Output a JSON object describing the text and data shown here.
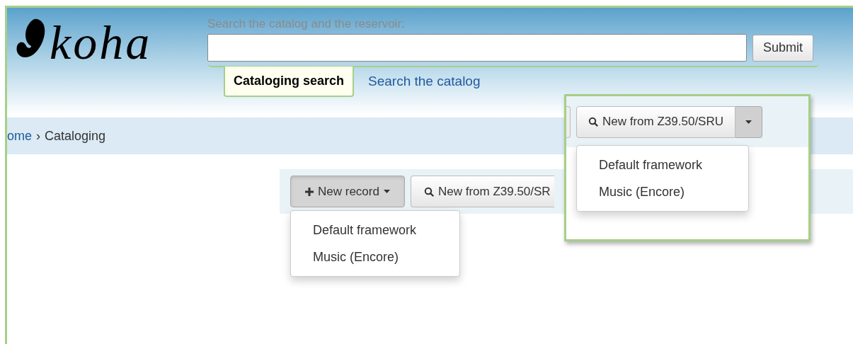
{
  "logo": {
    "text": "koha"
  },
  "search": {
    "label": "Search the catalog and the reservoir:",
    "submit": "Submit"
  },
  "tabs": [
    {
      "label": "Cataloging search",
      "selected": true
    },
    {
      "label": "Search the catalog",
      "selected": false
    }
  ],
  "breadcrumb": [
    {
      "label": "ome"
    },
    {
      "label": "Cataloging"
    }
  ],
  "breadcrumb_separator": "›",
  "toolbar": {
    "new_record": "New record",
    "z3950": "New from Z39.50/SR",
    "menu": [
      {
        "label": "Default framework"
      },
      {
        "label": "Music (Encore)"
      }
    ]
  },
  "callout": {
    "z3950": "New from Z39.50/SRU",
    "menu": [
      {
        "label": "Default framework"
      },
      {
        "label": "Music (Encore)"
      }
    ]
  }
}
